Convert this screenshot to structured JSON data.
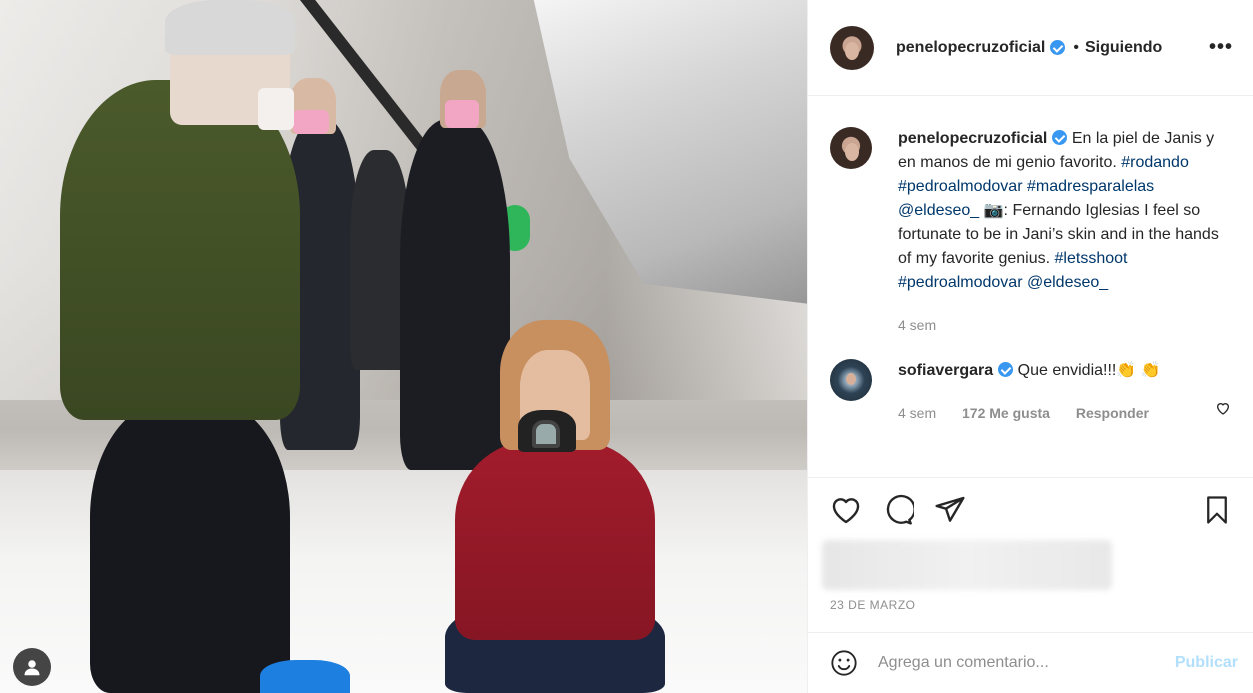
{
  "post": {
    "username": "penelopecruzoficial",
    "separator": "•",
    "follow_status": "Siguiendo",
    "more": "•••"
  },
  "caption": {
    "username": "penelopecruzoficial",
    "text_1": "En la piel de Janis y en manos de mi genio favorito. ",
    "tag_1": "#rodando",
    "tag_2": "#pedroalmodovar",
    "tag_3": "#madresparalelas",
    "tag_4": "@eldeseo_",
    "text_2": " 📷: Fernando Iglesias I feel so fortunate to be in Jani’s skin and in the hands of my favorite genius. ",
    "tag_5": "#letsshoot",
    "tag_6": "#pedroalmodovar",
    "tag_7": "@eldeseo_",
    "time": "4 sem"
  },
  "comment_1": {
    "username": "sofiavergara",
    "text": "Que envidia!!!👏 👏",
    "time": "4 sem",
    "likes": "172 Me gusta",
    "reply": "Responder"
  },
  "date": "23 DE MARZO",
  "add_comment": {
    "placeholder": "Agrega un comentario...",
    "publish": "Publicar"
  },
  "icons": {
    "like": "heart-icon",
    "comment": "comment-icon",
    "share": "paper-plane-icon",
    "save": "bookmark-icon",
    "emoji": "emoji-icon",
    "avatar_overlay": "user-icon"
  },
  "colors": {
    "link": "#00376b",
    "verified": "#3897f0",
    "publish_disabled": "#b2dffc",
    "muted": "#8e8e8e"
  }
}
